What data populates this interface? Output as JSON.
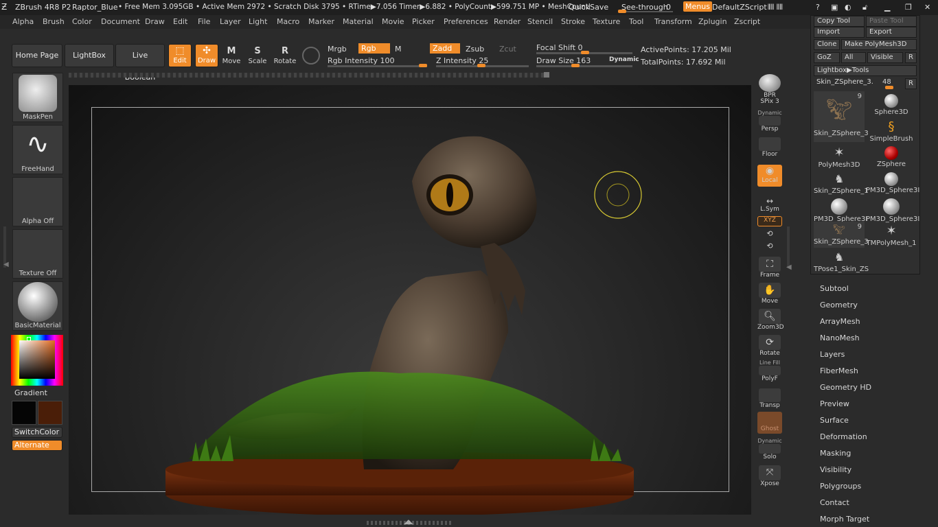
{
  "titlebar": {
    "app": "ZBrush 4R8 P2",
    "doc": "Raptor_Blue",
    "status": "• Free Mem 3.095GB • Active Mem 2972 • Scratch Disk 3795 • RTime▶7.056 Timer▶6.882 • PolyCount▶599.751 MP • MeshCountl",
    "quicksave": "QuickSave",
    "seethrough": "See-through",
    "seethrough_val": "0",
    "menus": "Menus",
    "script": "DefaultZScript"
  },
  "menu": [
    "Alpha",
    "Brush",
    "Color",
    "Document",
    "Draw",
    "Edit",
    "File",
    "Layer",
    "Light",
    "Macro",
    "Marker",
    "Material",
    "Movie",
    "Picker",
    "Preferences",
    "Render",
    "Stencil",
    "Stroke",
    "Texture",
    "Tool",
    "Transform",
    "Zplugin",
    "Zscript"
  ],
  "toolbar": {
    "home": "Home Page",
    "lightbox": "LightBox",
    "liveboolean": "Live Boolean",
    "edit": "Edit",
    "draw": "Draw",
    "move": "Move",
    "scale": "Scale",
    "rotate": "Rotate",
    "mrgb": "Mrgb",
    "rgb": "Rgb",
    "m": "M",
    "zadd": "Zadd",
    "zsub": "Zsub",
    "zcut": "Zcut",
    "rgb_intensity": "Rgb Intensity 100",
    "z_intensity": "Z Intensity 25",
    "focal_shift": "Focal Shift 0",
    "draw_size": "Draw Size 163",
    "dynamic": "Dynamic",
    "active_points": "ActivePoints: 17.205 Mil",
    "total_points": "TotalPoints: 17.692 Mil",
    "rgb_intensity_level": 100,
    "z_intensity_level": 25
  },
  "left": {
    "maskpen": "MaskPen",
    "freehand": "FreeHand",
    "alpha": "Alpha Off",
    "texture": "Texture Off",
    "material": "BasicMaterial",
    "gradient": "Gradient",
    "switchcolor": "SwitchColor",
    "alternate": "Alternate",
    "primary_color": "#050505",
    "secondary_color": "#4a1e08"
  },
  "righttools": {
    "bpr": "BPR",
    "spix": "SPix 3",
    "dynamic": "Dynamic",
    "persp": "Persp",
    "floor": "Floor",
    "local": "Local",
    "lsym": "L.Sym",
    "xyz": "XYZ",
    "frame": "Frame",
    "move": "Move",
    "zoom3d": "Zoom3D",
    "rotate": "Rotate",
    "linefill": "Line Fill",
    "polyf": "PolyF",
    "transp": "Transp",
    "ghost": "Ghost",
    "dynamic2": "Dynamic",
    "solo": "Solo",
    "xpose": "Xpose"
  },
  "rightpanel": {
    "copy_tool": "Copy Tool",
    "paste_tool": "Paste Tool",
    "import": "Import",
    "export": "Export",
    "clone": "Clone",
    "make_polymesh": "Make PolyMesh3D",
    "goz": "GoZ",
    "all": "All",
    "visible": "Visible",
    "r": "R",
    "lightbox_tools": "Lightbox▶Tools",
    "current_tool": "Skin_ZSphere_3.",
    "current_val": "48",
    "thumbs": [
      {
        "label": "Skin_ZSphere_3",
        "count": "9"
      },
      {
        "label": "Sphere3D"
      },
      {
        "label": "SimpleBrush"
      },
      {
        "label": "PolyMesh3D"
      },
      {
        "label": "ZSphere"
      },
      {
        "label": "Skin_ZSphere_1"
      },
      {
        "label": "PM3D_Sphere3I"
      },
      {
        "label": "PM3D_Sphere3I"
      },
      {
        "label": "PM3D_Sphere3I"
      },
      {
        "label": "Skin_ZSphere_3",
        "count": "9"
      },
      {
        "label": "TMPolyMesh_1"
      },
      {
        "label": "TPose1_Skin_ZS"
      }
    ]
  },
  "subpalettes": [
    "Subtool",
    "Geometry",
    "ArrayMesh",
    "NanoMesh",
    "Layers",
    "FiberMesh",
    "Geometry HD",
    "Preview",
    "Surface",
    "Deformation",
    "Masking",
    "Visibility",
    "Polygroups",
    "Contact",
    "Morph Target"
  ]
}
